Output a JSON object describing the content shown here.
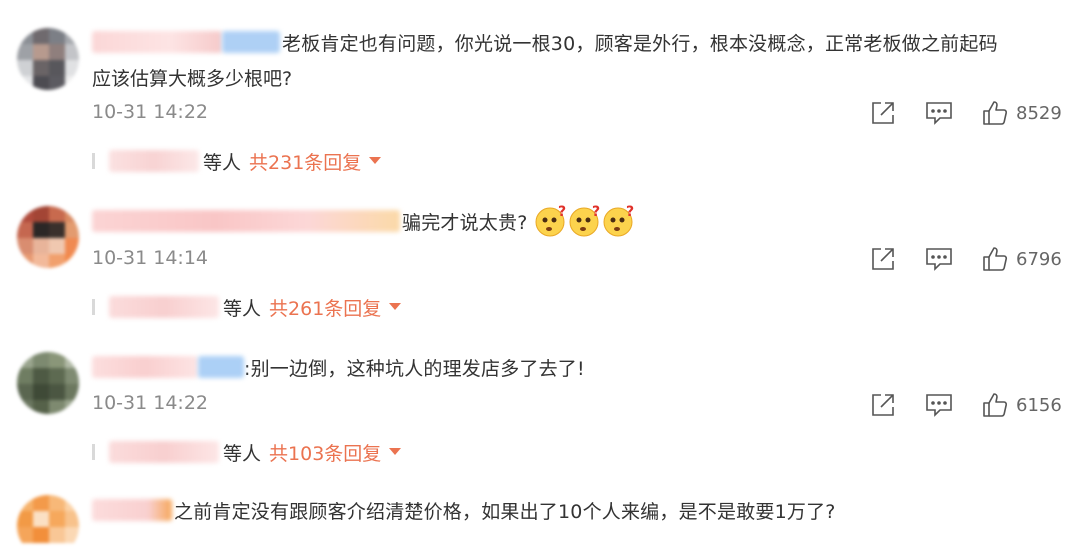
{
  "comments": [
    {
      "text": "老板肯定也有问题，你光说一根30，顾客是外行，根本没概念，正常老板做之前起码",
      "text2": "应该估算大概多少根吧?",
      "time": "10-31 14:22",
      "likes": "8529",
      "replies_users_suffix": "等人",
      "replies_count": "共231条回复"
    },
    {
      "text": "骗完才说太贵?",
      "emojis": [
        "confused-face-emoji",
        "confused-face-emoji",
        "confused-face-emoji"
      ],
      "time": "10-31 14:14",
      "likes": "6796",
      "replies_users_suffix": "等人",
      "replies_count": "共261条回复"
    },
    {
      "text": ":别一边倒，这种坑人的理发店多了去了!",
      "time": "10-31 14:22",
      "likes": "6156",
      "replies_users_suffix": "等人",
      "replies_count": "共103条回复"
    },
    {
      "text": "之前肯定没有跟顾客介绍清楚价格，如果出了10个人来编，是不是敢要1万了?"
    }
  ],
  "icons": {
    "share": "share-icon",
    "comment": "comment-icon",
    "like": "thumbs-up-icon",
    "expand": "caret-down-icon"
  },
  "colors": {
    "accent": "#eb7350",
    "time": "#8a8a8a",
    "icon": "#555555"
  }
}
